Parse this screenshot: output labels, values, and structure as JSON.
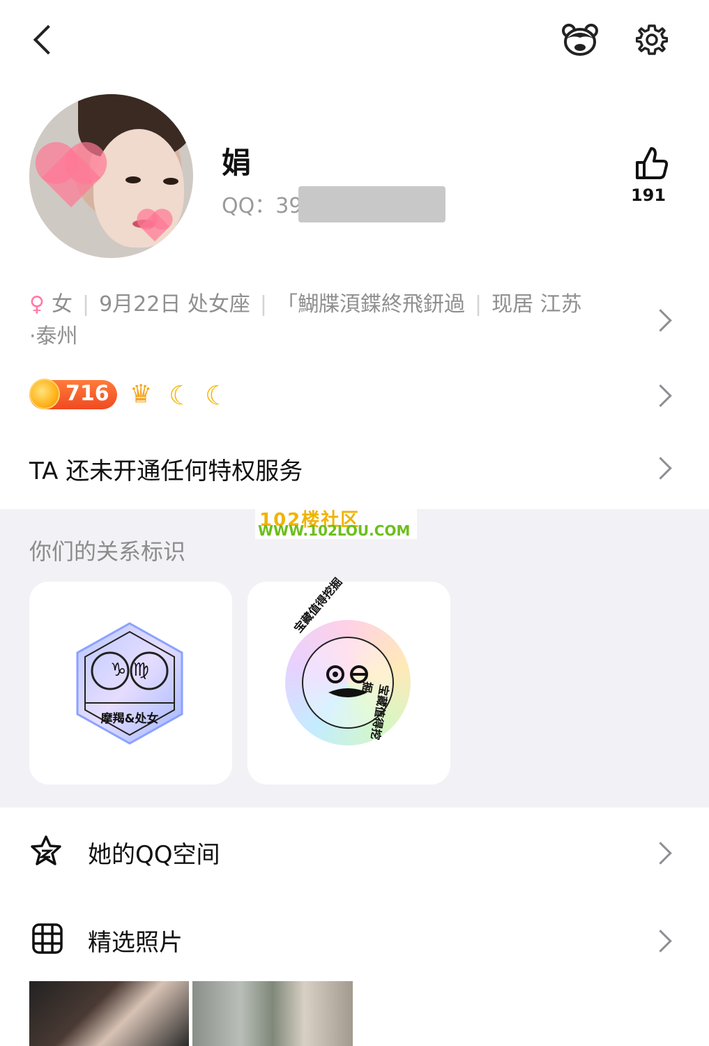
{
  "topbar": {
    "back_icon": "back-chevron-icon",
    "pet_icon": "bear-face-icon",
    "settings_icon": "gear-icon"
  },
  "profile": {
    "name": "娟",
    "qq_label": "QQ：39",
    "likes": "191",
    "like_icon": "thumbs-up-icon"
  },
  "info": {
    "gender_symbol": "♀",
    "gender": "女",
    "birthday": "9月22日 处女座",
    "signature": "「鰗牒湏鍱終飛鈃過",
    "location": "现居 江苏",
    "location_cont": "·泰州"
  },
  "levels": {
    "level_number": "716",
    "crown": "♛",
    "moons": [
      "☾",
      "☾"
    ]
  },
  "privilege": {
    "text": "TA 还未开通任何特权服务"
  },
  "watermark": {
    "line1": "102楼社区",
    "line2": "WWW.102LOU.COM"
  },
  "relations": {
    "title": "你们的关系标识",
    "cards": [
      {
        "badge_label": "摩羯&处女",
        "symbols": "♑ ♍"
      },
      {
        "ring_text_top": "宝藏值得挖掘",
        "ring_text_bottom": "宝藏值得挖掘"
      }
    ]
  },
  "menu": [
    {
      "label": "她的QQ空间",
      "icon": "qzone-star-icon"
    },
    {
      "label": "精选照片",
      "icon": "photo-grid-icon"
    }
  ],
  "colors": {
    "accent_orange": "#ef4a22",
    "gold": "#f5b400",
    "grey_bg": "#f2f2f6",
    "female_pink": "#ff7aa8"
  }
}
